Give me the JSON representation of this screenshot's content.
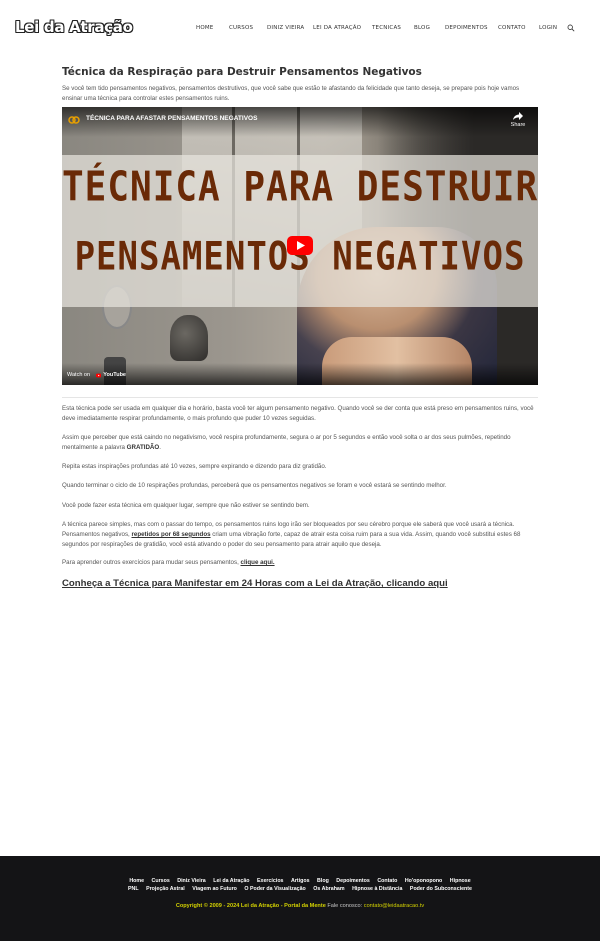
{
  "header": {
    "logo": "Lei da Atração",
    "nav": [
      "HOME",
      "CURSOS",
      "DINIZ VIEIRA",
      "LEI DA ATRAÇÃO",
      "TECNICAS",
      "BLOG",
      "DEPOIMENTOS",
      "CONTATO",
      "LOGIN"
    ],
    "search_icon": "search-icon"
  },
  "main": {
    "title": "Técnica da Respiração para Destruir Pensamentos Negativos",
    "intro": "Se você tem tido pensamentos negativos, pensamentos destrutivos, que você sabe que estão te afastando da felicidade que tanto deseja, se prepare pois hoje vamos ensinar uma técnica para controlar estes pensamentos ruins."
  },
  "video": {
    "title": "TÉCNICA PARA AFASTAR PENSAMENTOS NEGATIVOS",
    "share_label": "Share",
    "overlay_line1": "TÉCNICA PARA DESTRUIR",
    "overlay_line2": "PENSAMENTOS NEGATIVOS",
    "watch_on": "Watch on",
    "youtube_label": "YouTube",
    "colors": {
      "overlay_text": "#6a2a07",
      "play": "#ff0000"
    }
  },
  "body": {
    "p1": "Esta técnica pode ser usada em qualquer dia e horário, basta você ter algum pensamento negativo. Quando você se der conta que está preso em pensamentos ruins, você deve imediatamente respirar profundamente, o mais profundo que puder 10 vezes seguidas.",
    "p2_pre": "Assim que perceber que está caindo no negativismo, você respira profundamente, segura o ar por 5 segundos e então você solta o ar dos seus pulmões, repetindo mentalmente a palavra ",
    "p2_bold": "GRATIDÃO",
    "p2_post": ".",
    "p3": "Repita estas inspirações profundas até 10 vezes, sempre expirando e dizendo para diz gratidão.",
    "p4": "Quando terminar o ciclo de 10 respirações profundas, perceberá que os pensamentos negativos se foram e você estará se sentindo melhor.",
    "p5": "Você pode fazer esta técnica em qualquer lugar, sempre que não estiver se sentindo bem.",
    "p6_line1": "A técnica parece simples, mas com o passar do tempo, os pensamentos ruins logo irão ser bloqueados por seu cérebro porque ele saberá que você usará a técnica.",
    "p6_pre": "Pensamentos negativos, ",
    "p6_link": "repetidos por 68 segundos",
    "p6_post": " criam uma vibração forte, capaz de atrair esta coisa ruim para a sua vida. Assim, quando você substitui estes 68 segundos por respirações de gratidão, você está ativando o poder do seu pensamento para atrair aquilo que deseja.",
    "p7_pre": "Para aprender outros exercícios para mudar seus pensamentos, ",
    "p7_link": "clique aqui.",
    "cta": "Conheça a Técnica para Manifestar em 24 Horas com a Lei da Atração, clicando aqui"
  },
  "footer": {
    "row1": [
      "Home",
      "Cursos",
      "Diniz Vieira",
      "Lei da Atração",
      "Exercícios",
      "Artigos",
      "Blog",
      "Depoimentos",
      "Contato",
      "Ho'oponopono",
      "Hipnose"
    ],
    "row2": [
      "PNL",
      "Projeção Astral",
      "Viagem ao Futuro",
      "O Poder da Visualização",
      "Os Abraham",
      "Hipnose à Distância",
      "Poder do Subconsciente"
    ],
    "copyright": "Copyright © 2009 - 2024 Lei da Atração - Portal da Mente",
    "contact_label": " Fale conosco: ",
    "email": "contato@leidaatracao.tv",
    "colors": {
      "bg": "#141416",
      "accent": "#d4d200"
    }
  }
}
